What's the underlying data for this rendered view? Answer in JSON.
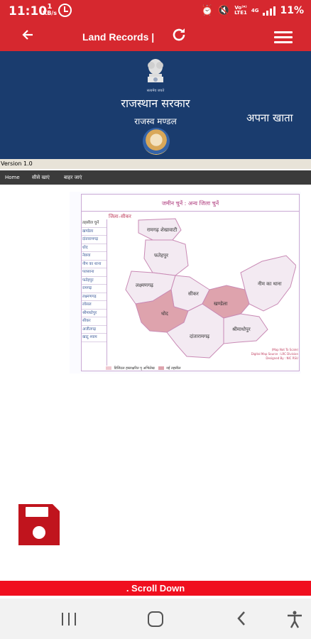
{
  "status_bar": {
    "time": "11:10",
    "net_speed_value": "1",
    "net_speed_unit": "KB/s",
    "volte": "Vo⁽ᴿ⁾",
    "lte": "LTE1",
    "network": "4G",
    "battery": "11%"
  },
  "toolbar": {
    "title": "Land Records |",
    "back_icon": "arrow-left",
    "refresh_icon": "refresh",
    "menu_icon": "hamburger"
  },
  "banner": {
    "emblem_caption": "सत्यमेव जयते",
    "title": "राजस्थान सरकार",
    "subtitle": "राजस्व मण्डल",
    "apna_khata": "अपना खाता"
  },
  "version": "Version 1.0",
  "nav_links": [
    "Home",
    "सीसे खाएं",
    "बाहर जाएं"
  ],
  "map": {
    "heading": "जमीन चुनें : अन्य जिला चुनें",
    "zila_label": "जिला–सीकर",
    "list_header": "तहसील चुनें",
    "tehsils": [
      "खण्डेला",
      "दांतारामगढ़",
      "धोद",
      "नेछवा",
      "नीम का थाना",
      "पलसाना",
      "फतेहपुर",
      "रामगढ़",
      "लक्ष्मणगढ़",
      "लोसल",
      "श्रीमाधोपुर",
      "सीकर",
      "अजीतगढ़",
      "खाटू श्याम"
    ],
    "regions": [
      "रामगढ़ शेखावाटी",
      "फतेहपुर",
      "लक्ष्मणगढ़",
      "सीकर",
      "धोद",
      "दांतारामगढ़",
      "खण्डेला",
      "श्रीमाधोपुर",
      "नीम का थाना"
    ],
    "credit_lines": [
      "(Map Not To Scale)",
      "Digital Map Source : LRC Division",
      "Designed By : NIC RSU"
    ],
    "legend_items": [
      "डिजिटल हस्ताक्षरित पृ अभिलेख",
      "नई तहसील"
    ],
    "colors": {
      "region": "#f3eaf2",
      "highlight": "#dea3ad",
      "border": "#c98ab5"
    }
  },
  "save_icon": "floppy-disk",
  "scroll_text": ". Scroll Down",
  "nav_bar": {
    "recents_icon": "recents",
    "home_icon": "home",
    "back_icon": "back",
    "accessibility_icon": "accessibility"
  }
}
